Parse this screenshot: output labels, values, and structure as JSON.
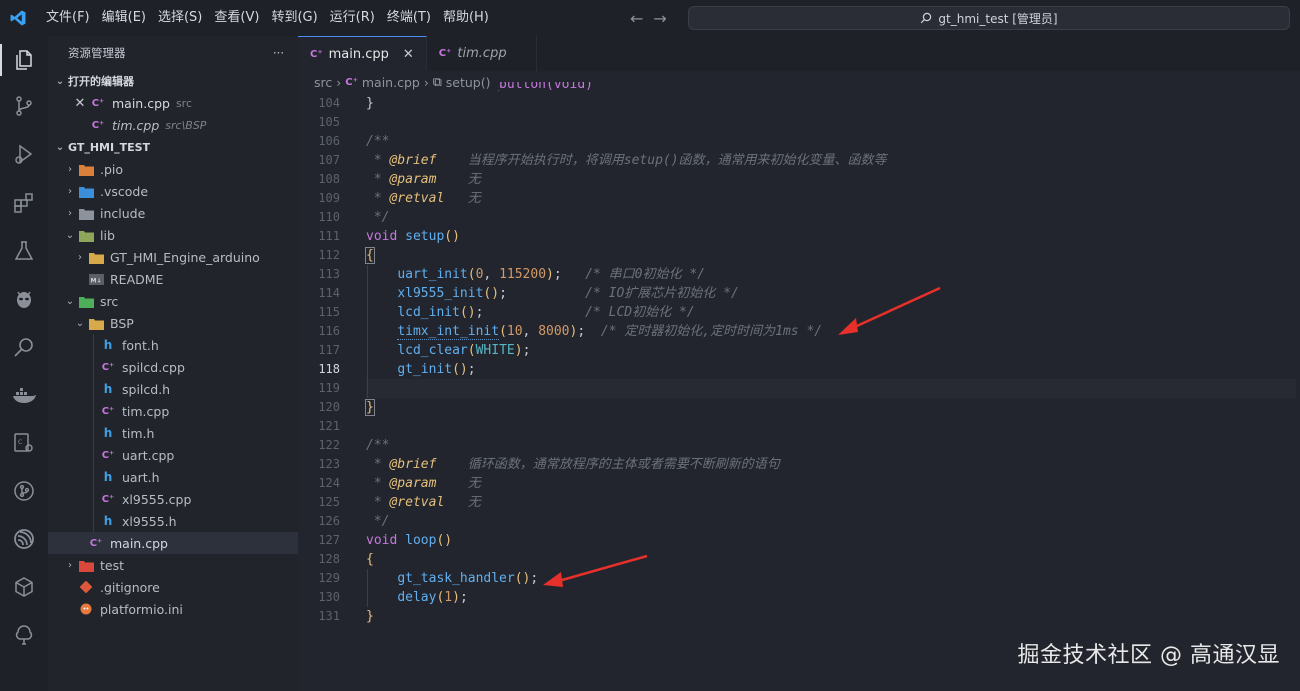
{
  "menu": [
    "文件(F)",
    "编辑(E)",
    "选择(S)",
    "查看(V)",
    "转到(G)",
    "运行(R)",
    "终端(T)",
    "帮助(H)"
  ],
  "command_center": {
    "title": "gt_hmi_test [管理员]"
  },
  "sidebar": {
    "header": "资源管理器",
    "more": "···",
    "open_editors_title": "打开的编辑器",
    "open_editors": [
      {
        "name": "main.cpp",
        "path": "src"
      },
      {
        "name": "tim.cpp",
        "path": "src\\BSP"
      }
    ],
    "project_title": "GT_HMI_TEST",
    "tree": {
      "pio": ".pio",
      "vscode": ".vscode",
      "include": "include",
      "lib": "lib",
      "gt_engine": "GT_HMI_Engine_arduino",
      "readme": "README",
      "src": "src",
      "bsp": "BSP",
      "bsp_files": [
        "font.h",
        "spilcd.cpp",
        "spilcd.h",
        "tim.cpp",
        "tim.h",
        "uart.cpp",
        "uart.h",
        "xl9555.cpp",
        "xl9555.h"
      ],
      "main": "main.cpp",
      "test": "test",
      "gitignore": ".gitignore",
      "platformio": "platformio.ini"
    }
  },
  "tabs": [
    {
      "label": "main.cpp",
      "close": "✕"
    },
    {
      "label": "tim.cpp"
    }
  ],
  "breadcrumb": [
    "src",
    "main.cpp",
    "setup()"
  ],
  "editor": {
    "line_numbers": [
      "104",
      "105",
      "106",
      "107",
      "108",
      "109",
      "110",
      "111",
      "112",
      "113",
      "114",
      "115",
      "116",
      "117",
      "118",
      "119",
      "120",
      "121",
      "122",
      "123",
      "124",
      "125",
      "126",
      "127",
      "128",
      "129",
      "130",
      "131"
    ],
    "current_line": "119",
    "lines": {
      "l103": "void gt_examples_button(void)",
      "l104": "}",
      "l106": "/**",
      "l107_tag": "@brief",
      "l107_text": "    当程序开始执行时，将调用setup()函数，通常用来初始化变量、函数等",
      "l108_tag": "@param",
      "l108_text": "    无",
      "l109_tag": "@retval",
      "l109_text": "   无",
      "l110": " */",
      "l111_kw": "void",
      "l111_fn": "setup",
      "l112": "{",
      "l113_fn": "uart_init",
      "l113_a1": "0",
      "l113_a2": "115200",
      "l113_cm": "/* 串口0初始化 */",
      "l114_fn": "xl9555_init",
      "l114_cm": "/* IO扩展芯片初始化 */",
      "l115_fn": "lcd_init",
      "l115_cm": "/* LCD初始化 */",
      "l116_fn": "timx_int_init",
      "l116_a1": "10",
      "l116_a2": "8000",
      "l116_cm": "/* 定时器初始化,定时时间为1ms */",
      "l117_fn": "lcd_clear",
      "l117_arg": "WHITE",
      "l118_fn": "gt_init",
      "l120": "}",
      "l122": "/**",
      "l123_tag": "@brief",
      "l123_text": "    循环函数，通常放程序的主体或者需要不断刷新的语句",
      "l124_tag": "@param",
      "l124_text": "    无",
      "l125_tag": "@retval",
      "l125_text": "   无",
      "l126": " */",
      "l127_kw": "void",
      "l127_fn": "loop",
      "l128": "{",
      "l129_fn": "gt_task_handler",
      "l130_fn": "delay",
      "l130_arg": "1",
      "l131": "}"
    }
  },
  "watermark": "掘金技术社区 @ 高通汉显",
  "colors": {
    "accent": "#4b8bf5",
    "annotation_arrow": "#e8302a",
    "keyword": "#c678dd",
    "function": "#61afef",
    "number": "#d19a66"
  }
}
